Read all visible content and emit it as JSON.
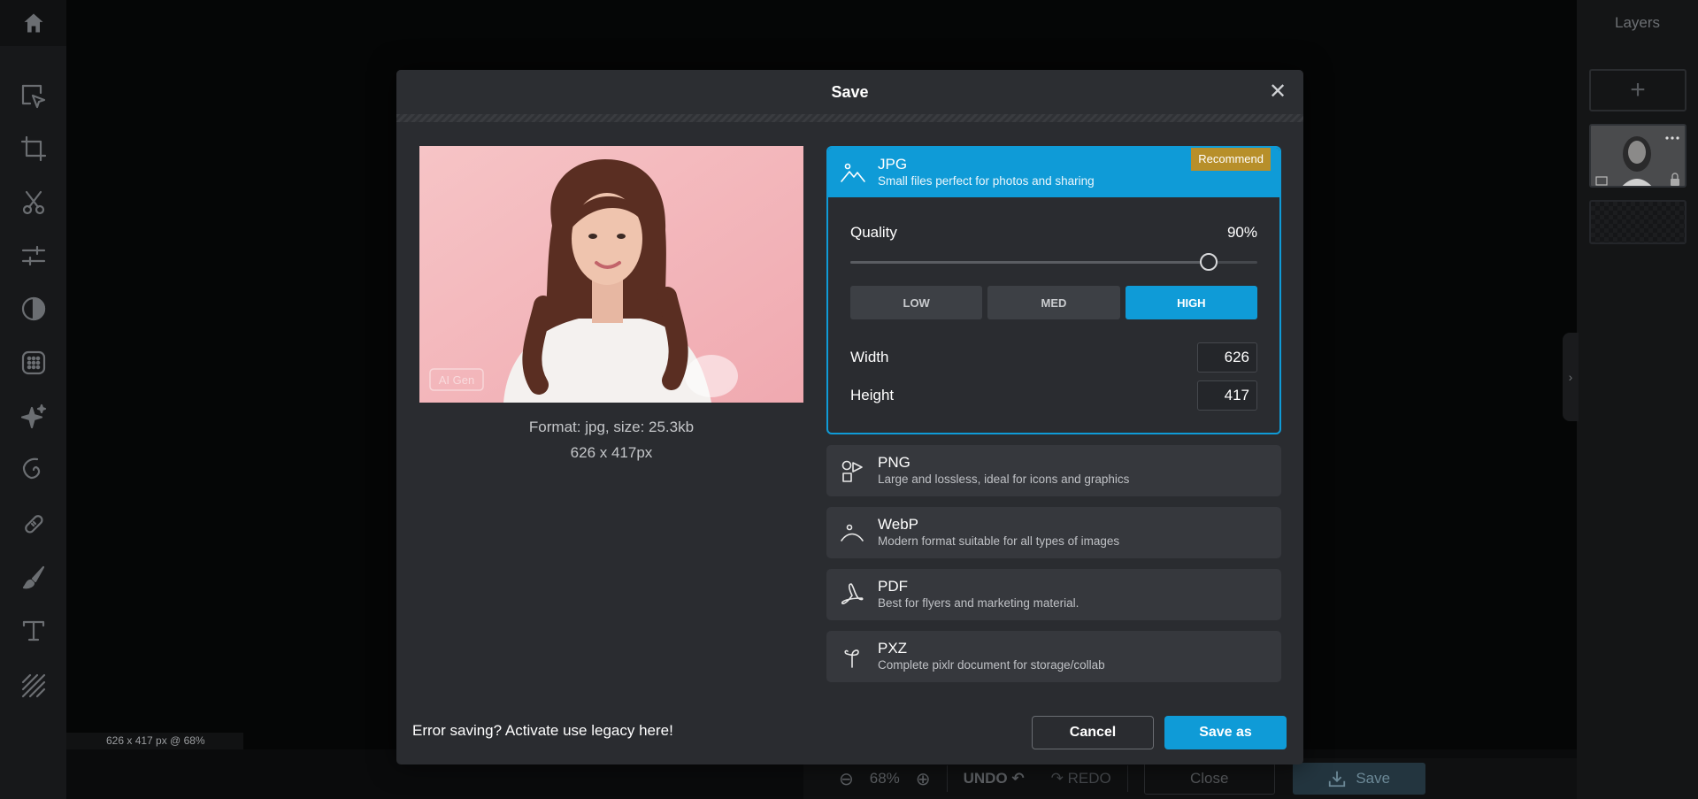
{
  "toolbar": {
    "icons": [
      "home-icon",
      "select-arrow-icon",
      "crop-icon",
      "scissors-icon",
      "adjust-sliders-icon",
      "contrast-icon",
      "filter-dots-icon",
      "sparkle-icon",
      "spiral-icon",
      "bandage-icon",
      "brush-icon",
      "text-icon",
      "pattern-icon"
    ]
  },
  "canvas": {
    "status": "626 x 417 px @ 68%"
  },
  "right_panel": {
    "title": "Layers",
    "add_label": "+"
  },
  "bottom_bar": {
    "zoom": "68%",
    "undo": "UNDO",
    "redo": "REDO",
    "close": "Close",
    "save": "Save"
  },
  "modal": {
    "title": "Save",
    "preview": {
      "watermark": "AI Gen",
      "format_info": "Format: jpg, size: 25.3kb",
      "dimensions": "626 x 417px"
    },
    "formats": [
      {
        "name": "JPG",
        "desc": "Small files perfect for photos and sharing",
        "badge": "Recommend",
        "icon": "landscape-icon",
        "selected": true
      },
      {
        "name": "PNG",
        "desc": "Large and lossless, ideal for icons and graphics",
        "icon": "shapes-icon"
      },
      {
        "name": "WebP",
        "desc": "Modern format suitable for all types of images",
        "icon": "webp-icon"
      },
      {
        "name": "PDF",
        "desc": "Best for flyers and marketing material.",
        "icon": "pdf-icon"
      },
      {
        "name": "PXZ",
        "desc": "Complete pixlr document for storage/collab",
        "icon": "pxz-icon"
      }
    ],
    "jpg_options": {
      "quality_label": "Quality",
      "quality_value": "90%",
      "quality_fraction": 0.88,
      "presets": [
        "LOW",
        "MED",
        "HIGH"
      ],
      "active_preset": "HIGH",
      "width_label": "Width",
      "width_value": "626",
      "height_label": "Height",
      "height_value": "417"
    },
    "legacy_text": "Error saving? Activate use legacy here!",
    "cancel": "Cancel",
    "save_as": "Save as"
  },
  "colors": {
    "accent": "#0f9bd7",
    "recommend": "#b78f2a",
    "modal_bg": "#2a2c30"
  }
}
